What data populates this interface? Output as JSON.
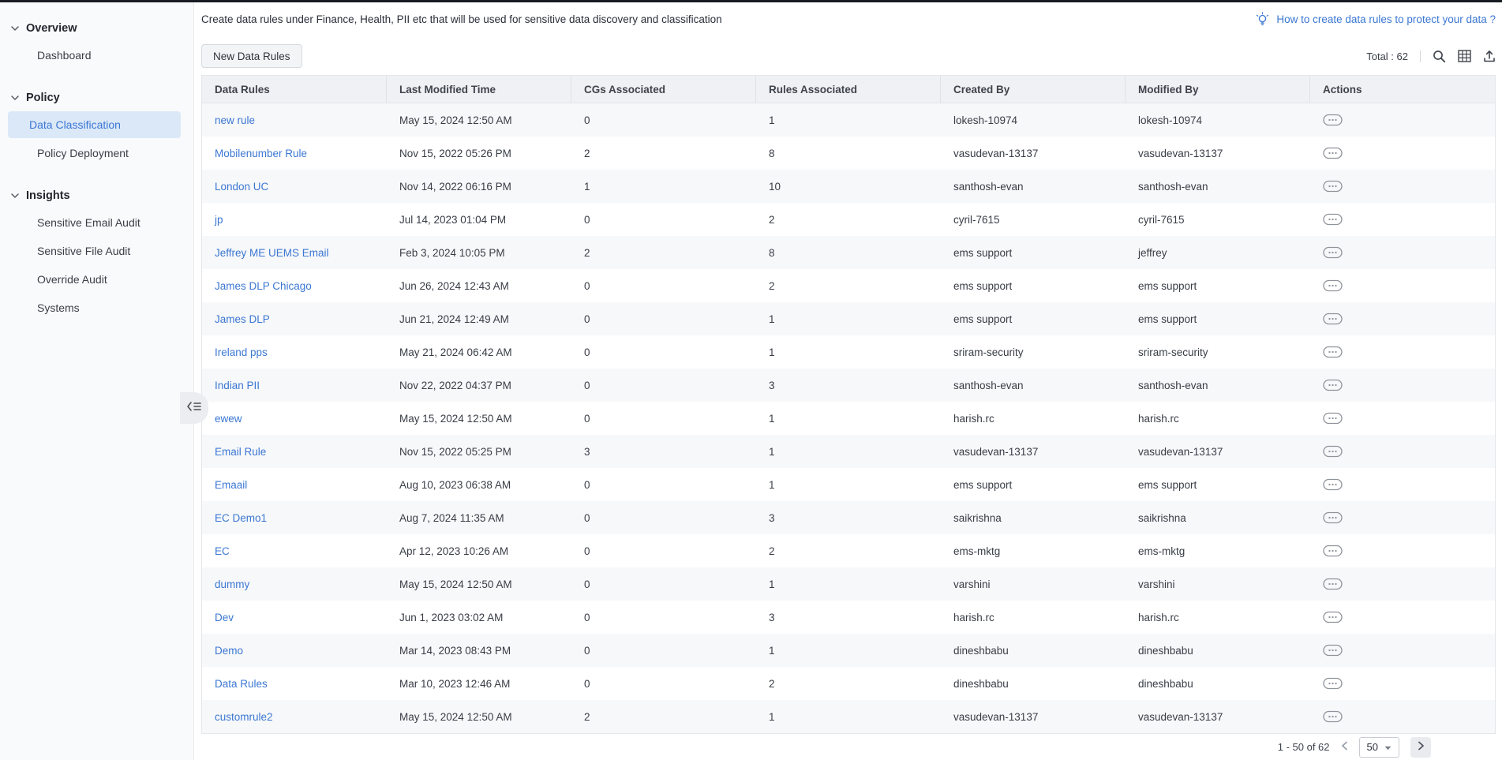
{
  "banner": {
    "text": "Create data rules under Finance, Health, PII etc that will be used for sensitive data discovery and classification",
    "help_link": "How to create data rules to protect your data ?"
  },
  "sidebar": {
    "sections": [
      {
        "label": "Overview",
        "items": [
          {
            "label": "Dashboard",
            "active": false
          }
        ]
      },
      {
        "label": "Policy",
        "items": [
          {
            "label": "Data Classification",
            "active": true
          },
          {
            "label": "Policy Deployment",
            "active": false
          }
        ]
      },
      {
        "label": "Insights",
        "items": [
          {
            "label": "Sensitive Email Audit",
            "active": false
          },
          {
            "label": "Sensitive File Audit",
            "active": false
          },
          {
            "label": "Override Audit",
            "active": false
          },
          {
            "label": "Systems",
            "active": false
          }
        ]
      }
    ]
  },
  "toolbar": {
    "new_button": "New Data Rules",
    "total_label": "Total : 62",
    "icons": [
      "search-icon",
      "column-chooser-icon",
      "export-icon"
    ]
  },
  "table": {
    "columns": [
      "Data Rules",
      "Last Modified Time",
      "CGs Associated",
      "Rules Associated",
      "Created By",
      "Modified By",
      "Actions"
    ],
    "rows": [
      {
        "name": "new rule",
        "last_modified": "May 15, 2024 12:50 AM",
        "cgs": "0",
        "rules": "1",
        "created_by": "lokesh-10974",
        "modified_by": "lokesh-10974"
      },
      {
        "name": "Mobilenumber Rule",
        "last_modified": "Nov 15, 2022 05:26 PM",
        "cgs": "2",
        "rules": "8",
        "created_by": "vasudevan-13137",
        "modified_by": "vasudevan-13137"
      },
      {
        "name": "London UC",
        "last_modified": "Nov 14, 2022 06:16 PM",
        "cgs": "1",
        "rules": "10",
        "created_by": "santhosh-evan",
        "modified_by": "santhosh-evan"
      },
      {
        "name": "jp",
        "last_modified": "Jul 14, 2023 01:04 PM",
        "cgs": "0",
        "rules": "2",
        "created_by": "cyril-7615",
        "modified_by": "cyril-7615"
      },
      {
        "name": "Jeffrey ME UEMS Email",
        "last_modified": "Feb 3, 2024 10:05 PM",
        "cgs": "2",
        "rules": "8",
        "created_by": "ems support",
        "modified_by": "jeffrey"
      },
      {
        "name": "James DLP Chicago",
        "last_modified": "Jun 26, 2024 12:43 AM",
        "cgs": "0",
        "rules": "2",
        "created_by": "ems support",
        "modified_by": "ems support"
      },
      {
        "name": "James DLP",
        "last_modified": "Jun 21, 2024 12:49 AM",
        "cgs": "0",
        "rules": "1",
        "created_by": "ems support",
        "modified_by": "ems support"
      },
      {
        "name": "Ireland pps",
        "last_modified": "May 21, 2024 06:42 AM",
        "cgs": "0",
        "rules": "1",
        "created_by": "sriram-security",
        "modified_by": "sriram-security"
      },
      {
        "name": "Indian PII",
        "last_modified": "Nov 22, 2022 04:37 PM",
        "cgs": "0",
        "rules": "3",
        "created_by": "santhosh-evan",
        "modified_by": "santhosh-evan"
      },
      {
        "name": "ewew",
        "last_modified": "May 15, 2024 12:50 AM",
        "cgs": "0",
        "rules": "1",
        "created_by": "harish.rc",
        "modified_by": "harish.rc"
      },
      {
        "name": "Email Rule",
        "last_modified": "Nov 15, 2022 05:25 PM",
        "cgs": "3",
        "rules": "1",
        "created_by": "vasudevan-13137",
        "modified_by": "vasudevan-13137"
      },
      {
        "name": "Emaail",
        "last_modified": "Aug 10, 2023 06:38 AM",
        "cgs": "0",
        "rules": "1",
        "created_by": "ems support",
        "modified_by": "ems support"
      },
      {
        "name": "EC Demo1",
        "last_modified": "Aug 7, 2024 11:35 AM",
        "cgs": "0",
        "rules": "3",
        "created_by": "saikrishna",
        "modified_by": "saikrishna"
      },
      {
        "name": "EC",
        "last_modified": "Apr 12, 2023 10:26 AM",
        "cgs": "0",
        "rules": "2",
        "created_by": "ems-mktg",
        "modified_by": "ems-mktg"
      },
      {
        "name": "dummy",
        "last_modified": "May 15, 2024 12:50 AM",
        "cgs": "0",
        "rules": "1",
        "created_by": "varshini",
        "modified_by": "varshini"
      },
      {
        "name": "Dev",
        "last_modified": "Jun 1, 2023 03:02 AM",
        "cgs": "0",
        "rules": "3",
        "created_by": "harish.rc",
        "modified_by": "harish.rc"
      },
      {
        "name": "Demo",
        "last_modified": "Mar 14, 2023 08:43 PM",
        "cgs": "0",
        "rules": "1",
        "created_by": "dineshbabu",
        "modified_by": "dineshbabu"
      },
      {
        "name": "Data Rules",
        "last_modified": "Mar 10, 2023 12:46 AM",
        "cgs": "0",
        "rules": "2",
        "created_by": "dineshbabu",
        "modified_by": "dineshbabu"
      },
      {
        "name": "customrule2",
        "last_modified": "May 15, 2024 12:50 AM",
        "cgs": "2",
        "rules": "1",
        "created_by": "vasudevan-13137",
        "modified_by": "vasudevan-13137"
      }
    ]
  },
  "pagination": {
    "range": "1 - 50 of 62",
    "page_size": "50"
  },
  "icons": {
    "help": "lightbulb-icon",
    "section_toggle": "chevron-down-icon",
    "collapse": "collapse-sidebar-icon",
    "row_actions": "more-actions-icon",
    "prev": "chevron-left-icon",
    "next": "chevron-right-icon"
  },
  "colors": {
    "accent_blue": "#3b77d3",
    "selected_bg": "#dbe8f8",
    "zebra_row": "#f7f8fa"
  }
}
